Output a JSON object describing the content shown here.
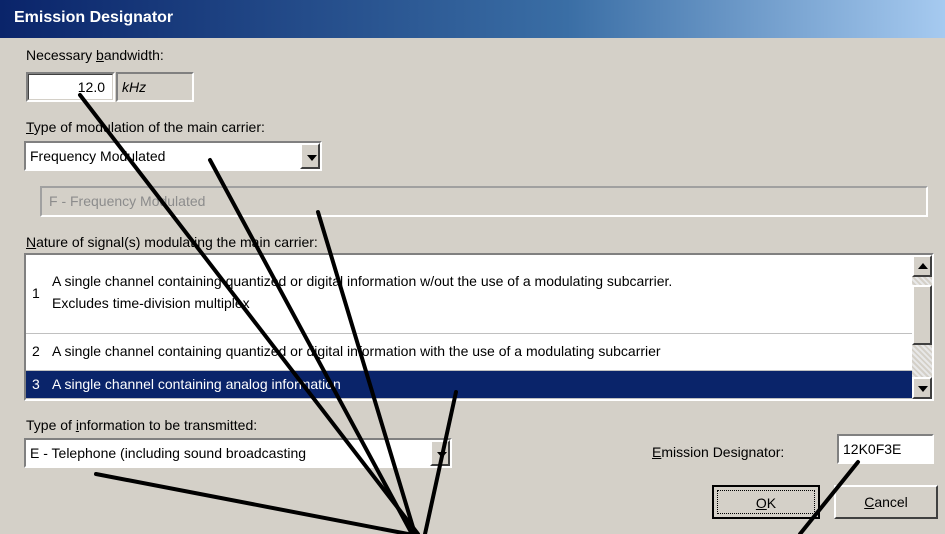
{
  "window": {
    "title": "Emission Designator"
  },
  "bandwidth": {
    "label_pre": "Necessary ",
    "label_u": "b",
    "label_post": "andwidth:",
    "value": "12.0",
    "unit": "kHz"
  },
  "modulation": {
    "label_pre": "",
    "label_u": "T",
    "label_post": "ype of modulation of the main carrier:",
    "selected": "Frequency Modulated",
    "description": "F - Frequency Modulated"
  },
  "nature": {
    "label_pre": "",
    "label_u": "N",
    "label_post": "ature of signal(s) modulating the main carrier:",
    "rows": [
      {
        "num": "1",
        "line1": "A single channel containing quantized or digital information w/out the use of a modulating subcarrier.",
        "line2": "Excludes time-division multiplex"
      },
      {
        "num": "2",
        "line1": "A single channel containing quantized or digital information with the use of a modulating subcarrier",
        "line2": ""
      },
      {
        "num": "3",
        "line1": "A single channel containing analog information",
        "line2": ""
      }
    ]
  },
  "info_type": {
    "label_pre": "Type of ",
    "label_u": "i",
    "label_post": "nformation to be transmitted:",
    "selected": "E - Telephone (including sound broadcasting"
  },
  "designator": {
    "label_u": "E",
    "label_post": "mission Designator:",
    "value": "12K0F3E"
  },
  "buttons": {
    "ok_u": "O",
    "ok_post": "K",
    "cancel_u": "C",
    "cancel_post": "ancel"
  }
}
